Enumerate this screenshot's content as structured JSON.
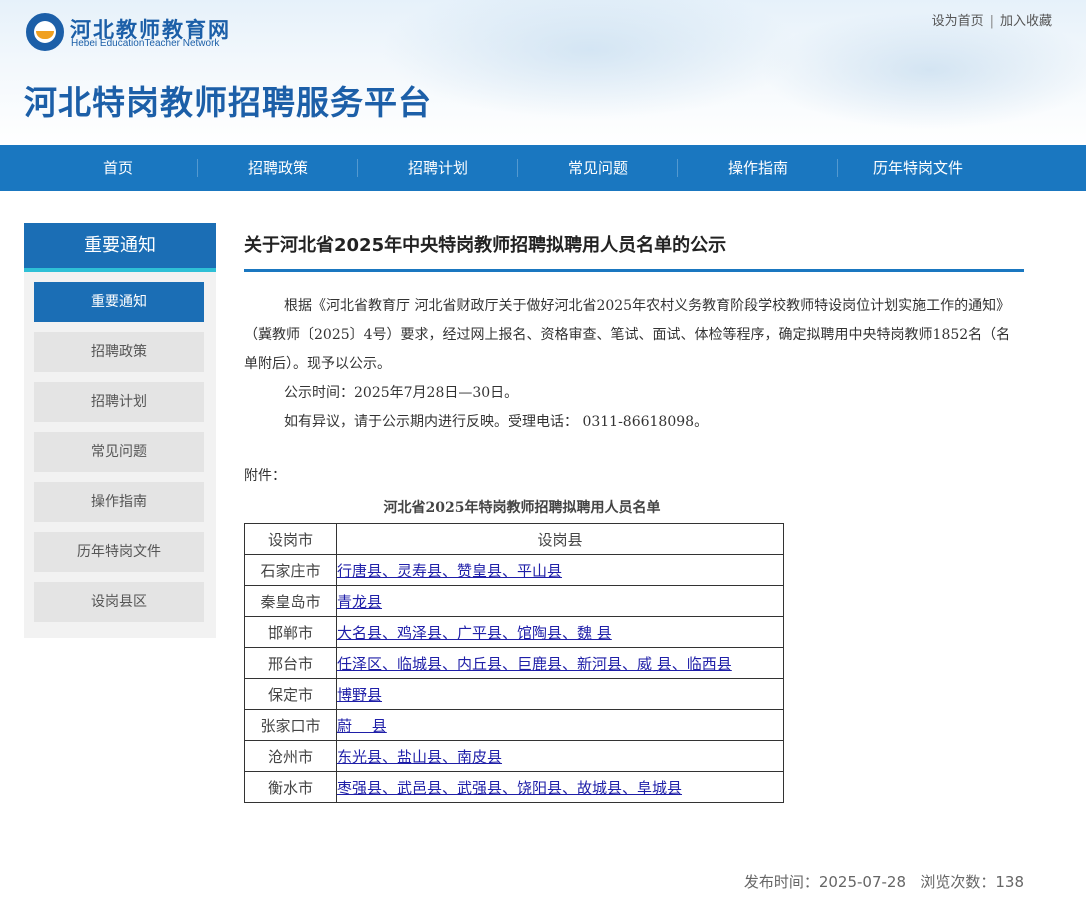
{
  "header": {
    "logo_cn": "河北教师教育网",
    "logo_en": "Hebei EducationTeacher Network",
    "site_title": "河北特岗教师招聘服务平台",
    "top_links": [
      "设为首页",
      "加入收藏"
    ]
  },
  "nav": {
    "items": [
      "首页",
      "招聘政策",
      "招聘计划",
      "常见问题",
      "操作指南",
      "历年特岗文件"
    ]
  },
  "sidebar": {
    "heading": "重要通知",
    "items": [
      "重要通知",
      "招聘政策",
      "招聘计划",
      "常见问题",
      "操作指南",
      "历年特岗文件",
      "设岗县区"
    ],
    "active_index": 0
  },
  "article": {
    "title": "关于河北省2025年中央特岗教师招聘拟聘用人员名单的公示",
    "paragraph1": "根据《河北省教育厅 河北省财政厅关于做好河北省2025年农村义务教育阶段学校教师特设岗位计划实施工作的通知》（冀教师〔2025〕4号）要求，经过网上报名、资格审查、笔试、面试、体检等程序，确定拟聘用中央特岗教师1852名（名单附后）。现予以公示。",
    "paragraph2": "公示时间：2025年7月28日—30日。",
    "paragraph3": "如有异议，请于公示期内进行反映。受理电话： 0311-86618098。",
    "attachment_label": "附件：",
    "list_title": "河北省2025年特岗教师招聘拟聘用人员名单",
    "table": {
      "headers": [
        "设岗市",
        "设岗县"
      ],
      "rows": [
        {
          "city": "石家庄市",
          "counties": "行唐县、灵寿县、赞皇县、平山县"
        },
        {
          "city": "秦皇岛市",
          "counties": "青龙县"
        },
        {
          "city": "邯郸市",
          "counties": "大名县、鸡泽县、广平县、馆陶县、魏 县"
        },
        {
          "city": "邢台市",
          "counties": "任泽区、临城县、内丘县、巨鹿县、新河县、威 县、临西县"
        },
        {
          "city": "保定市",
          "counties": "博野县"
        },
        {
          "city": "张家口市",
          "counties": "蔚　 县"
        },
        {
          "city": "沧州市",
          "counties": "东光县、盐山县、南皮县"
        },
        {
          "city": "衡水市",
          "counties": "枣强县、武邑县、武强县、饶阳县、故城县、阜城县"
        }
      ]
    },
    "meta": {
      "publish_label": "发布时间：",
      "publish_date": "2025-07-28",
      "views_label": "浏览次数：",
      "views_count": "138"
    }
  }
}
